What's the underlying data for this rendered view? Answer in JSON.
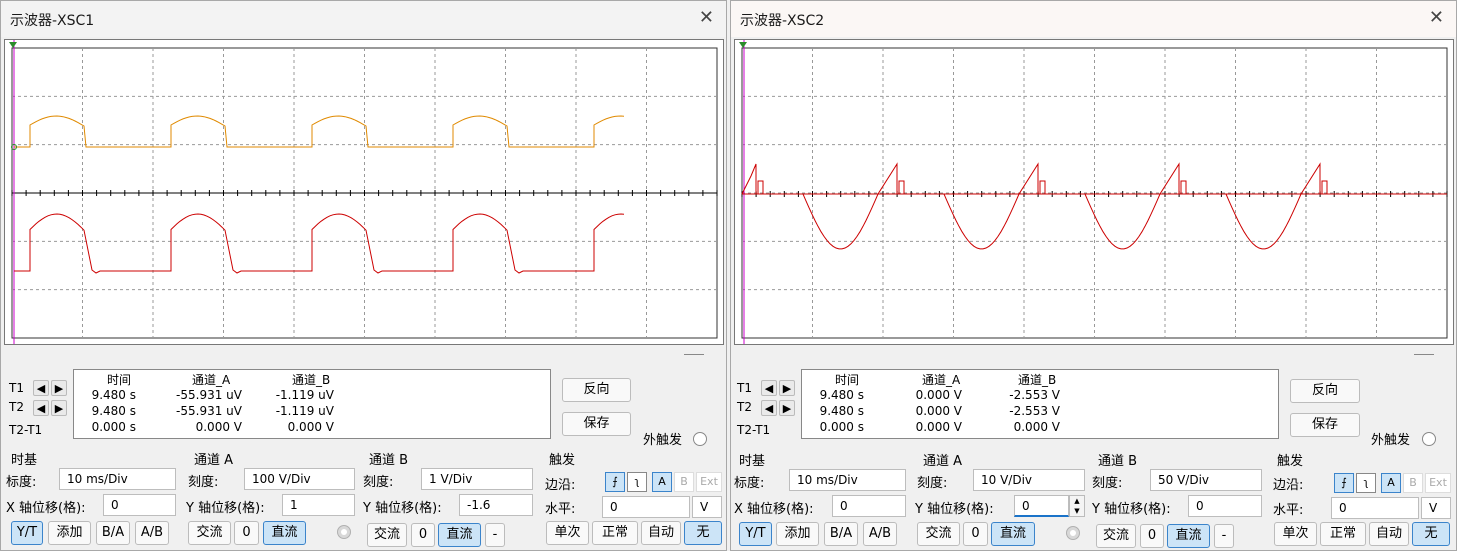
{
  "windows": [
    {
      "title": "示波器-XSC1",
      "colors": {
        "channel_a": "#e08a00",
        "channel_b": "#cc0000"
      },
      "waveform_a": "half-wave rectified pulses (orange) above baseline",
      "readout": {
        "headers": [
          "时间",
          "通道_A",
          "通道_B"
        ],
        "rows": [
          {
            "label": "T1",
            "time": "9.480 s",
            "a": "-55.931 uV",
            "b": "-1.119 uV"
          },
          {
            "label": "T2",
            "time": "9.480 s",
            "a": "-55.931 uV",
            "b": "-1.119 uV"
          },
          {
            "label": "T2-T1",
            "time": "0.000 s",
            "a": "0.000 V",
            "b": "0.000 V"
          }
        ]
      },
      "buttons": {
        "reverse": "反向",
        "save": "保存",
        "ext_trigger": "外触发"
      },
      "timebase": {
        "title": "时基",
        "scale_label": "标度:",
        "scale": "10 ms/Div",
        "xpos_label": "X 轴位移(格):",
        "xpos": "0",
        "modes": [
          "Y/T",
          "添加",
          "B/A",
          "A/B"
        ]
      },
      "channel_a": {
        "title": "通道 A",
        "scale_label": "刻度:",
        "scale": "100  V/Div",
        "ypos_label": "Y 轴位移(格):",
        "ypos": "1",
        "coupling": [
          "交流",
          "0",
          "直流"
        ]
      },
      "channel_b": {
        "title": "通道 B",
        "scale_label": "刻度:",
        "scale": "1  V/Div",
        "ypos_label": "Y 轴位移(格):",
        "ypos": "-1.6",
        "coupling": [
          "交流",
          "0",
          "直流",
          "-"
        ]
      },
      "trigger": {
        "title": "触发",
        "edge_label": "边沿:",
        "level_label": "水平:",
        "level": "0",
        "level_unit": "V",
        "sources": [
          "A",
          "B",
          "Ext"
        ],
        "modes": [
          "单次",
          "正常",
          "自动",
          "无"
        ]
      }
    },
    {
      "title": "示波器-XSC2",
      "colors": {
        "channel_a": "#cc0000",
        "channel_b": "#cc0000"
      },
      "readout": {
        "headers": [
          "时间",
          "通道_A",
          "通道_B"
        ],
        "rows": [
          {
            "label": "T1",
            "time": "9.480 s",
            "a": "0.000 V",
            "b": "-2.553 V"
          },
          {
            "label": "T2",
            "time": "9.480 s",
            "a": "0.000 V",
            "b": "-2.553 V"
          },
          {
            "label": "T2-T1",
            "time": "0.000 s",
            "a": "0.000 V",
            "b": "0.000 V"
          }
        ]
      },
      "buttons": {
        "reverse": "反向",
        "save": "保存",
        "ext_trigger": "外触发"
      },
      "timebase": {
        "title": "时基",
        "scale_label": "标度:",
        "scale": "10 ms/Div",
        "xpos_label": "X 轴位移(格):",
        "xpos": "0",
        "modes": [
          "Y/T",
          "添加",
          "B/A",
          "A/B"
        ]
      },
      "channel_a": {
        "title": "通道 A",
        "scale_label": "刻度:",
        "scale": "10  V/Div",
        "ypos_label": "Y 轴位移(格):",
        "ypos": "0",
        "coupling": [
          "交流",
          "0",
          "直流"
        ]
      },
      "channel_b": {
        "title": "通道 B",
        "scale_label": "刻度:",
        "scale": "50  V/Div",
        "ypos_label": "Y 轴位移(格):",
        "ypos": "0",
        "coupling": [
          "交流",
          "0",
          "直流",
          "-"
        ]
      },
      "trigger": {
        "title": "触发",
        "edge_label": "边沿:",
        "level_label": "水平:",
        "level": "0",
        "level_unit": "V",
        "sources": [
          "A",
          "B",
          "Ext"
        ],
        "modes": [
          "单次",
          "正常",
          "自动",
          "无"
        ]
      }
    }
  ]
}
